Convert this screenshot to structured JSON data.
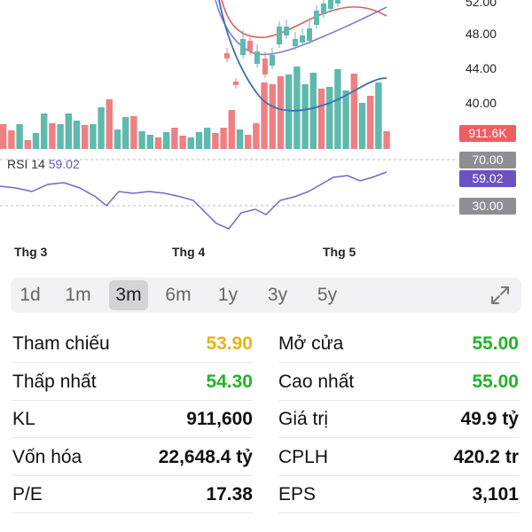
{
  "chart": {
    "price_labels": [
      "52.00",
      "48.00",
      "44.00",
      "40.00"
    ],
    "volume_tag": "911.6K",
    "rsi_upper_tag": "70.00",
    "rsi_value_tag": "59.02",
    "rsi_lower_tag": "30.00",
    "rsi_name": "RSI 14",
    "rsi_value": "59.02",
    "months": [
      "Thg 3",
      "Thg 4",
      "Thg 5"
    ],
    "colors": {
      "up": "#5fb9ad",
      "down": "#ef7f83",
      "rsi": "#7b62c9",
      "ma_red": "#e35b5b",
      "ma_purple": "#8a7ad6",
      "ma_blue": "#3d6fb3",
      "vol_tag": "#ef5d63",
      "grey_tag": "#8e8e93",
      "rsi_tag": "#6a52c4"
    }
  },
  "ranges": {
    "buttons": [
      "1d",
      "1m",
      "3m",
      "6m",
      "1y",
      "3y",
      "5y"
    ],
    "active": "3m",
    "expand_icon": "expand-arrows-icon"
  },
  "stats": [
    {
      "left_label": "Tham chiếu",
      "left_value": "53.90",
      "left_color": "#e7b417",
      "right_label": "Mở cửa",
      "right_value": "55.00",
      "right_color": "#1fb525"
    },
    {
      "left_label": "Thấp nhất",
      "left_value": "54.30",
      "left_color": "#1fb525",
      "right_label": "Cao nhất",
      "right_value": "55.00",
      "right_color": "#1fb525"
    },
    {
      "left_label": "KL",
      "left_value": "911,600",
      "left_color": "#111111",
      "right_label": "Giá trị",
      "right_value": "49.9 tỷ",
      "right_color": "#111111"
    },
    {
      "left_label": "Vốn hóa",
      "left_value": "22,648.4 tỷ",
      "left_color": "#111111",
      "right_label": "CPLH",
      "right_value": "420.2 tr",
      "right_color": "#111111"
    },
    {
      "left_label": "P/E",
      "left_value": "17.38",
      "left_color": "#111111",
      "right_label": "EPS",
      "right_value": "3,101",
      "right_color": "#111111"
    }
  ]
}
